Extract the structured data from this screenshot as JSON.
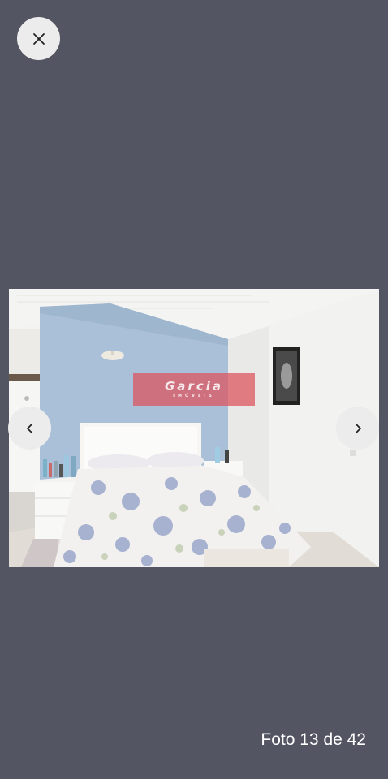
{
  "viewer": {
    "photo_label": "Foto 13 de 42",
    "watermark": {
      "brand": "Garcia",
      "tagline": "IMÓVEIS"
    }
  },
  "icons": {
    "close": "close-icon",
    "previous": "chevron-left-icon",
    "next": "chevron-right-icon"
  },
  "colors": {
    "background": "#545563",
    "button": "#ececec",
    "watermark": "#dc505a"
  }
}
